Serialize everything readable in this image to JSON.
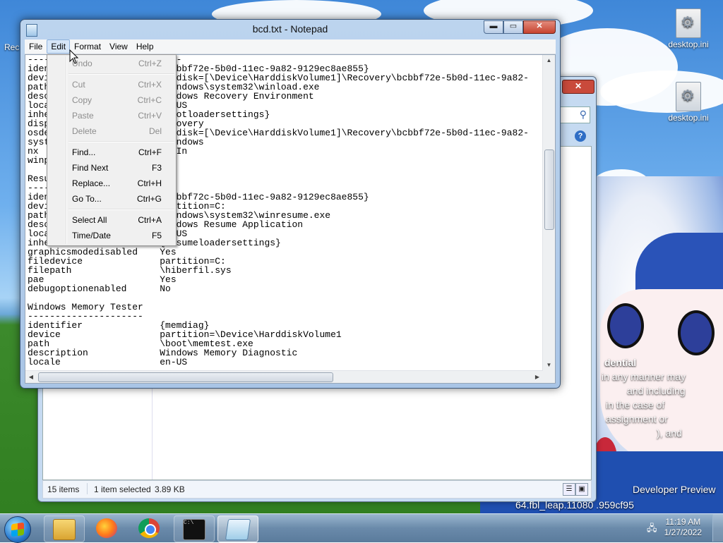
{
  "desktop": {
    "icons": [
      {
        "label": "desktop.ini"
      },
      {
        "label": "desktop.ini"
      }
    ],
    "left_partial_label": "Rec",
    "overlay_lines": [
      "dential",
      "in any manner may",
      "and including",
      "in the case of",
      "assignment or",
      "), and",
      "Developer Preview",
      "64.fbl_leap.11080 .959cf95"
    ]
  },
  "explorer": {
    "close_label": "✕",
    "search_icon": "search-icon",
    "help_label": "?",
    "status": {
      "item_count": "15 items",
      "selection": "1 item selected",
      "size": "3.89 KB"
    }
  },
  "notepad": {
    "title": "bcd.txt - Notepad",
    "controls": {
      "minimize": "▬",
      "maximize": "▭",
      "close": "✕"
    },
    "menu": [
      "File",
      "Edit",
      "Format",
      "View",
      "Help"
    ],
    "active_menu": "Edit",
    "lines": [
      "----------------------------",
      "identifier              {bcbbf72e-5b0d-11ec-9a82-9129ec8ae855}",
      "device                  ramdisk=[\\Device\\HarddiskVolume1]\\Recovery\\bcbbf72e-5b0d-11ec-9a82-",
      "path                    \\windows\\system32\\winload.exe",
      "description             Windows Recovery Environment",
      "locale                  en-US",
      "inherit                 {bootloadersettings}",
      "displaymessage          Recovery",
      "osdevice                ramdisk=[\\Device\\HarddiskVolume1]\\Recovery\\bcbbf72e-5b0d-11ec-9a82-",
      "systemroot              \\windows",
      "nx                      OptIn",
      "winpe                   Yes",
      "",
      "Resume from Hibernate",
      "---------------------",
      "identifier              {bcbbf72c-5b0d-11ec-9a82-9129ec8ae855}",
      "device                  partition=C:",
      "path                    \\Windows\\system32\\winresume.exe",
      "description             Windows Resume Application",
      "locale                  en-US",
      "inherit                 {resumeloadersettings}",
      "graphicsmodedisabled    Yes",
      "filedevice              partition=C:",
      "filepath                \\hiberfil.sys",
      "pae                     Yes",
      "debugoptionenabled      No",
      "",
      "Windows Memory Tester",
      "---------------------",
      "identifier              {memdiag}",
      "device                  partition=\\Device\\HarddiskVolume1",
      "path                    \\boot\\memtest.exe",
      "description             Windows Memory Diagnostic",
      "locale                  en-US"
    ],
    "edit_menu": [
      {
        "label": "Undo",
        "shortcut": "Ctrl+Z",
        "enabled": false
      },
      {
        "label": "Cut",
        "shortcut": "Ctrl+X",
        "enabled": false
      },
      {
        "label": "Copy",
        "shortcut": "Ctrl+C",
        "enabled": false
      },
      {
        "label": "Paste",
        "shortcut": "Ctrl+V",
        "enabled": false
      },
      {
        "label": "Delete",
        "shortcut": "Del",
        "enabled": false
      },
      {
        "label": "Find...",
        "shortcut": "Ctrl+F",
        "enabled": true
      },
      {
        "label": "Find Next",
        "shortcut": "F3",
        "enabled": true
      },
      {
        "label": "Replace...",
        "shortcut": "Ctrl+H",
        "enabled": true
      },
      {
        "label": "Go To...",
        "shortcut": "Ctrl+G",
        "enabled": true
      },
      {
        "label": "Select All",
        "shortcut": "Ctrl+A",
        "enabled": true
      },
      {
        "label": "Time/Date",
        "shortcut": "F5",
        "enabled": true
      }
    ]
  },
  "taskbar": {
    "apps": [
      "file-explorer-icon",
      "firefox-icon",
      "chrome-icon",
      "cmd-icon",
      "notepad-icon"
    ],
    "time": "11:19 AM",
    "date": "1/27/2022"
  }
}
